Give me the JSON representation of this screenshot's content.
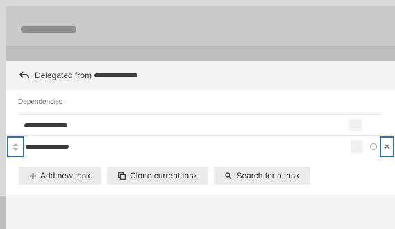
{
  "modal": {
    "header_title": "",
    "delegated_label": "Delegated from",
    "delegated_name": ""
  },
  "dependencies": {
    "section_title": "Dependencies",
    "items": [
      {
        "name": ""
      },
      {
        "name": ""
      }
    ]
  },
  "actions": {
    "add_label": "Add new task",
    "clone_label": "Clone current task",
    "search_label": "Search for a task"
  },
  "icons": {
    "reply": "reply-arrow-icon",
    "sort": "sort-handle-icon",
    "close": "close-icon",
    "plus": "plus-icon",
    "clone": "clone-icon",
    "search": "search-icon"
  },
  "colors": {
    "focus_outline": "#2d6fb8",
    "header": "#c9c9c9"
  }
}
